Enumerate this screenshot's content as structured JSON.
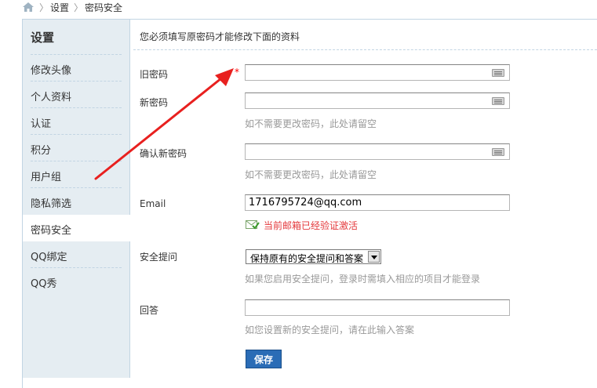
{
  "breadcrumb": {
    "items": [
      "设置",
      "密码安全"
    ],
    "separator": "〉"
  },
  "sidebar": {
    "title": "设置",
    "items": [
      {
        "label": "修改头像"
      },
      {
        "label": "个人资料"
      },
      {
        "label": "认证"
      },
      {
        "label": "积分"
      },
      {
        "label": "用户组"
      },
      {
        "label": "隐私筛选"
      },
      {
        "label": "密码安全",
        "active": true
      },
      {
        "label": "QQ绑定"
      },
      {
        "label": "QQ秀"
      }
    ]
  },
  "main": {
    "notice": "您必须填写原密码才能修改下面的资料",
    "required_mark": "*",
    "fields": {
      "old_password": {
        "label": "旧密码",
        "value": ""
      },
      "new_password": {
        "label": "新密码",
        "value": "",
        "hint": "如不需要更改密码，此处请留空"
      },
      "confirm_password": {
        "label": "确认新密码",
        "value": "",
        "hint": "如不需要更改密码，此处请留空"
      },
      "email": {
        "label": "Email",
        "value": "1716795724@qq.com",
        "verified_text": "当前邮箱已经验证激活"
      },
      "security_question": {
        "label": "安全提问",
        "selected": "保持原有的安全提问和答案",
        "hint": "如果您启用安全提问，登录时需填入相应的项目才能登录"
      },
      "answer": {
        "label": "回答",
        "value": "",
        "hint": "如您设置新的安全提问，请在此输入答案"
      }
    },
    "save_label": "保存"
  },
  "colors": {
    "sidebar_bg": "#e5edf2",
    "border": "#c2d5e3",
    "annotation_arrow": "#e8201f",
    "verified_text": "#e4393c",
    "save_button": "#2a6cb6"
  },
  "icons": [
    "home-icon",
    "keyboard-icon",
    "envelope-check-icon",
    "dropdown-arrow-icon"
  ]
}
